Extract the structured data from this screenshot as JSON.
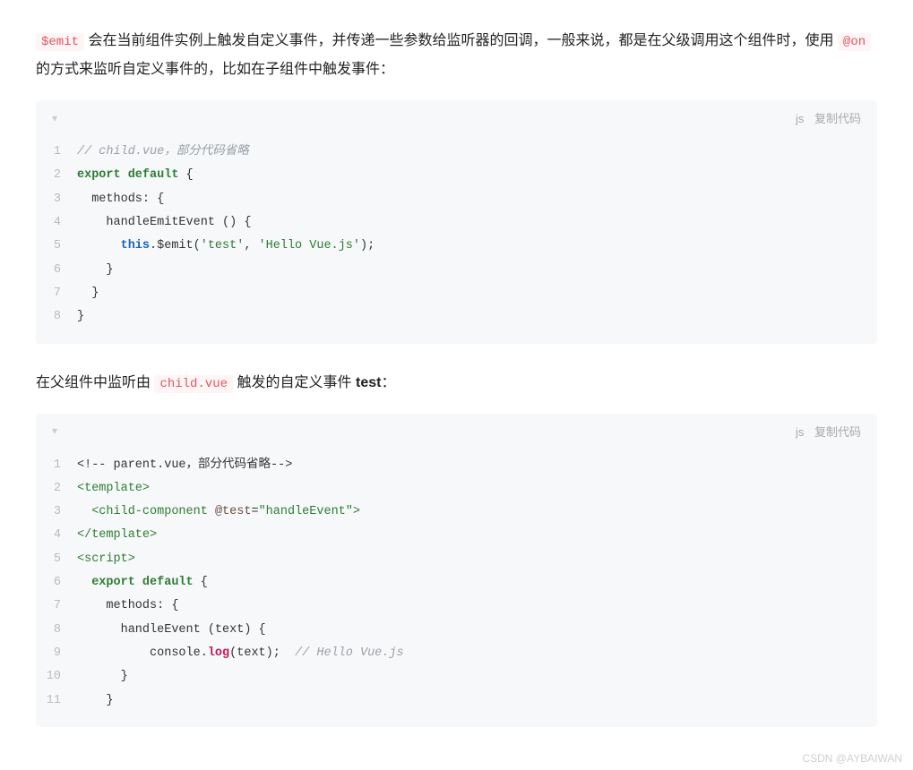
{
  "para1": {
    "code1": "$emit",
    "t1": " 会在当前组件实例上触发自定义事件，并传递一些参数给监听器的回调，一般来说，都是在父级调用这个组件时，使用 ",
    "code2": "@on",
    "t2": " 的方式来监听自定义事件的，比如在子组件中触发事件："
  },
  "codeblock1": {
    "lang": "js",
    "copy": "复制代码",
    "lines": [
      {
        "n": "1",
        "html": "<span class='tok-comment'>// child.vue，部分代码省略</span>"
      },
      {
        "n": "2",
        "html": "<span class='tok-keyword'>export default</span> {"
      },
      {
        "n": "3",
        "html": "  methods: {"
      },
      {
        "n": "4",
        "html": "    handleEmitEvent () {"
      },
      {
        "n": "5",
        "html": "      <span class='tok-keyword2'>this</span>.$emit(<span class='tok-string'>'test'</span>, <span class='tok-string'>'Hello Vue.js'</span>);"
      },
      {
        "n": "6",
        "html": "    }"
      },
      {
        "n": "7",
        "html": "  }"
      },
      {
        "n": "8",
        "html": "}"
      }
    ]
  },
  "para2": {
    "t1": "在父组件中监听由 ",
    "code1": "child.vue",
    "t2": " 触发的自定义事件 ",
    "bold1": "test",
    "t3": "："
  },
  "codeblock2": {
    "lang": "js",
    "copy": "复制代码",
    "lines": [
      {
        "n": "1",
        "html": "&lt;!-- parent.vue，部分代码省略--&gt;"
      },
      {
        "n": "2",
        "html": "<span class='tok-tag'>&lt;template&gt;</span>"
      },
      {
        "n": "3",
        "html": "  <span class='tok-tag'>&lt;child-component</span> <span class='tok-attr'>@test</span>=<span class='tok-string'>\"handleEvent\"</span><span class='tok-tag'>&gt;</span>"
      },
      {
        "n": "4",
        "html": "<span class='tok-tag'>&lt;/template&gt;</span>"
      },
      {
        "n": "5",
        "html": "<span class='tok-tag'>&lt;script&gt;</span>"
      },
      {
        "n": "6",
        "html": "  <span class='tok-keyword'>export default</span> {"
      },
      {
        "n": "7",
        "html": "    methods: {"
      },
      {
        "n": "8",
        "html": "      handleEvent (text) {"
      },
      {
        "n": "9",
        "html": "          console.<span class='tok-method'>log</span>(text);  <span class='tok-comment'>// Hello Vue.js</span>"
      },
      {
        "n": "10",
        "html": "      }"
      },
      {
        "n": "11",
        "html": "    }"
      }
    ]
  },
  "watermark": "CSDN @AYBAIWAN"
}
